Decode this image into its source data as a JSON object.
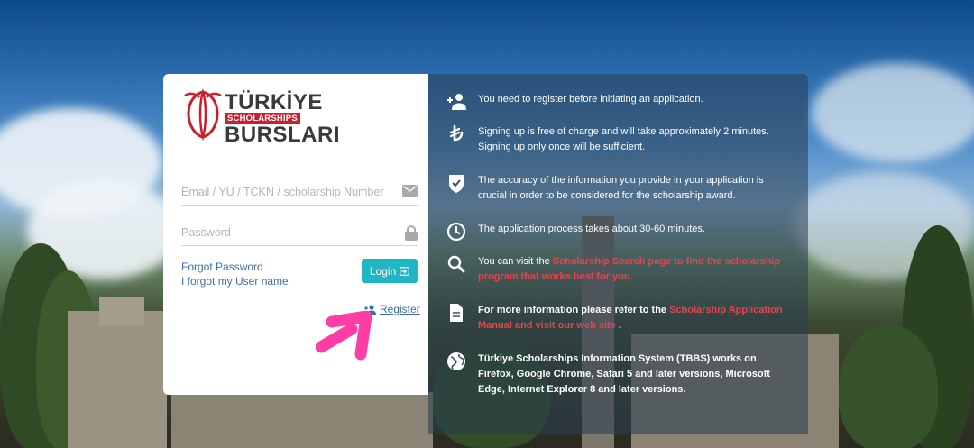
{
  "logo": {
    "line1": "TÜRKİYE",
    "line2": "SCHOLARSHIPS",
    "line3": "BURSLARI",
    "color_red": "#c8202f"
  },
  "login": {
    "email_placeholder": "Email / YU / TCKN / scholarship Number",
    "password_placeholder": "Password",
    "forgot_password": "Forgot Password",
    "forgot_username": "I forgot my User name",
    "login_label": "Login",
    "register_label": "Register",
    "accent_color": "#21b6c4"
  },
  "info": {
    "row1": "You need to register before initiating an application.",
    "row2": "Signing up is free of charge and will take approximately 2 minutes. Signing up only once will be sufficient.",
    "row3": "The accuracy of the information you provide in your application is crucial in order to be considered for the scholarship award.",
    "row4": "The application process takes about 30-60 minutes.",
    "row5_prefix": "You can visit the ",
    "row5_link": "Scholarship Search page to find the scholarship program that works best for you.",
    "row6_prefix": "For more information please refer to the ",
    "row6_link": "Scholarship Application Manual and visit our web site",
    "row6_suffix": ".",
    "row7": "Türkiye Scholarships Information System (TBBS) works on Firefox, Google Chrome, Safari 5 and later versions, Microsoft Edge, Internet Explorer 8 and later versions."
  },
  "icons": [
    "add-user-icon",
    "lira-icon",
    "shield-check-icon",
    "clock-icon",
    "search-icon",
    "document-icon",
    "globe-icon",
    "email-icon",
    "lock-icon",
    "login-icon",
    "add-person-icon",
    "arrow-annotation"
  ]
}
